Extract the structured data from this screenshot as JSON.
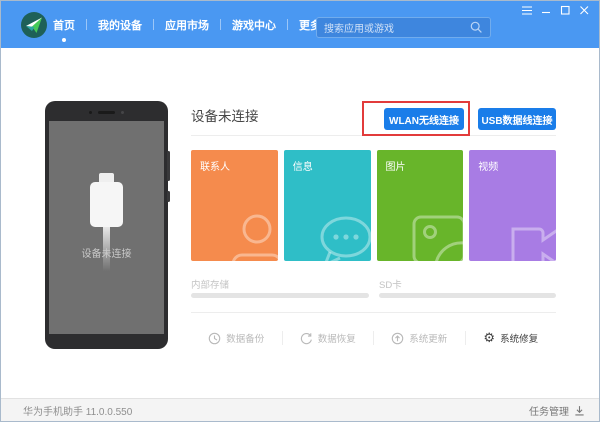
{
  "colors": {
    "header_blue": "#4a98f2",
    "button_blue": "#1a7de9",
    "annotation_red": "#e23b3b"
  },
  "header": {
    "nav": [
      {
        "label": "首页",
        "active": true
      },
      {
        "label": "我的设备",
        "active": false
      },
      {
        "label": "应用市场",
        "active": false
      },
      {
        "label": "游戏中心",
        "active": false
      },
      {
        "label": "更多服务",
        "active": false
      }
    ],
    "search": {
      "placeholder": "搜索应用或游戏"
    },
    "window_controls": [
      {
        "icon": "menu-icon"
      },
      {
        "icon": "minimize-icon"
      },
      {
        "icon": "maximize-icon"
      },
      {
        "icon": "close-icon"
      }
    ]
  },
  "device_preview": {
    "status_text": "设备未连接"
  },
  "main": {
    "title": "设备未连接",
    "buttons": {
      "wlan": "WLAN无线连接",
      "usb": "USB数据线连接"
    },
    "annotation": {
      "shape": "red-rectangle",
      "target": "wlan-button",
      "color": "#e23b3b"
    },
    "tiles": [
      {
        "label": "联系人",
        "color": "#f58b4d",
        "icon": "contacts-icon"
      },
      {
        "label": "信息",
        "color": "#2fbec7",
        "icon": "message-icon"
      },
      {
        "label": "图片",
        "color": "#68b52a",
        "icon": "pictures-icon"
      },
      {
        "label": "视频",
        "color": "#a87ce4",
        "icon": "video-camera-icon"
      }
    ],
    "storage": [
      {
        "label": "内部存储"
      },
      {
        "label": "SD卡"
      }
    ],
    "actions": [
      {
        "label": "数据备份",
        "icon": "backup-clock-icon",
        "enabled": false
      },
      {
        "label": "数据恢复",
        "icon": "restore-arrow-icon",
        "enabled": false
      },
      {
        "label": "系统更新",
        "icon": "update-arrow-icon",
        "enabled": false
      },
      {
        "label": "系统修复",
        "icon": "gear-icon",
        "enabled": true
      }
    ]
  },
  "footer": {
    "app_version": "华为手机助手 11.0.0.550",
    "task_manager": "任务管理"
  }
}
